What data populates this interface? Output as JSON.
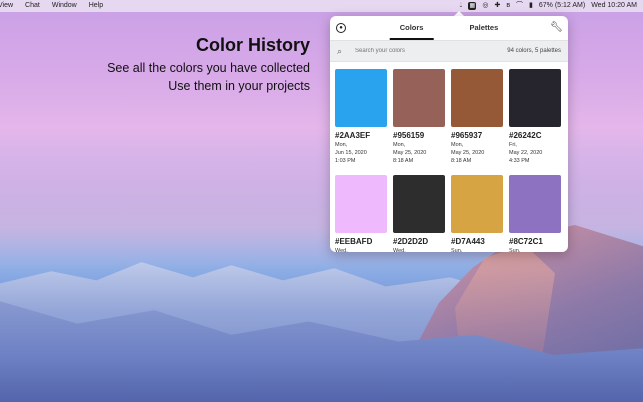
{
  "menubar": {
    "left_items": [
      "View",
      "Chat",
      "Window",
      "Help"
    ],
    "right": {
      "battery": "67% (5:12 AM)",
      "clock": "Wed 10:20 AM"
    }
  },
  "headline": {
    "title": "Color History",
    "line1": "See all the colors you have collected",
    "line2": "Use them in your projects"
  },
  "popover": {
    "tabs": [
      "Colors",
      "Palettes"
    ],
    "active_tab": "Colors",
    "search": {
      "placeholder": "Search your colors",
      "count": "94 colors, 5 palettes"
    },
    "colors": [
      {
        "hex": "#2AA3EF",
        "color": "#2AA3EF",
        "date": [
          "Mon,",
          "Jun 15, 2020",
          "1:03 PM"
        ]
      },
      {
        "hex": "#956159",
        "color": "#956159",
        "date": [
          "Mon,",
          "May 25, 2020",
          "8:18 AM"
        ]
      },
      {
        "hex": "#965937",
        "color": "#965937",
        "date": [
          "Mon,",
          "May 25, 2020",
          "8:18 AM"
        ]
      },
      {
        "hex": "#26242C",
        "color": "#26242C",
        "date": [
          "Fri,",
          "May 22, 2020",
          "4:33 PM"
        ]
      },
      {
        "hex": "#EEBAFD",
        "color": "#EEBAFD",
        "date": [
          "Wed,",
          "",
          ""
        ]
      },
      {
        "hex": "#2D2D2D",
        "color": "#2D2D2D",
        "date": [
          "Wed,",
          "",
          ""
        ]
      },
      {
        "hex": "#D7A443",
        "color": "#D7A443",
        "date": [
          "Sun,",
          "",
          ""
        ]
      },
      {
        "hex": "#8C72C1",
        "color": "#8C72C1",
        "date": [
          "Sun,",
          "",
          ""
        ]
      }
    ]
  }
}
